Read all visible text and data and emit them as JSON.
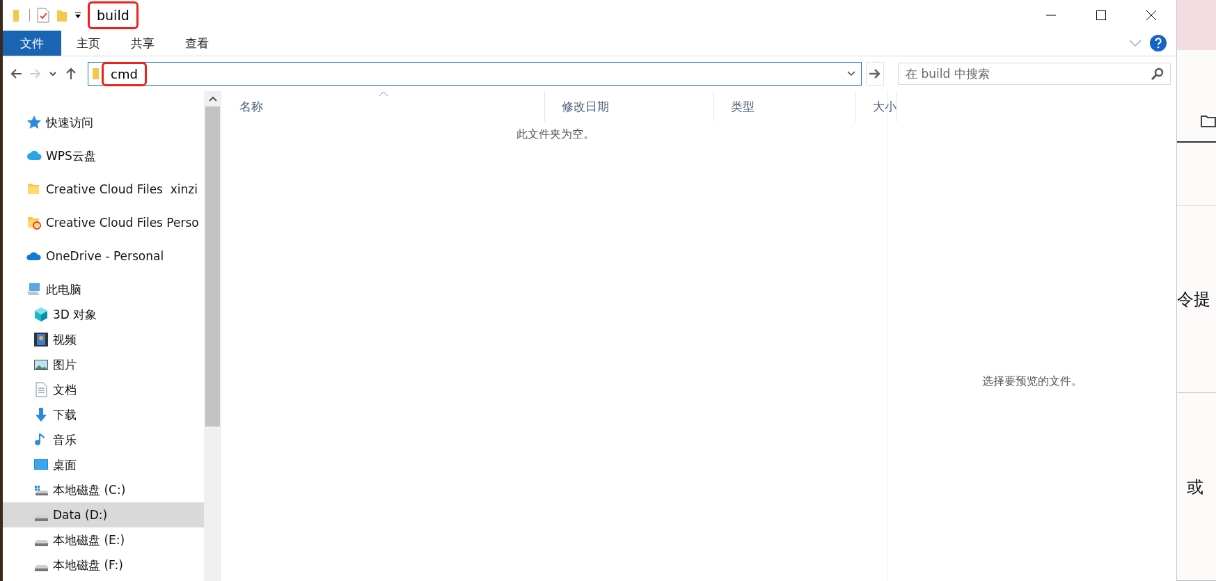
{
  "title_bar": {
    "title": "build",
    "title_highlighted": true
  },
  "ribbon": {
    "tabs": [
      {
        "label": "文件",
        "kind": "file-menu",
        "selected": false
      },
      {
        "label": "主页",
        "kind": "tab",
        "selected": false
      },
      {
        "label": "共享",
        "kind": "tab",
        "selected": false
      },
      {
        "label": "查看",
        "kind": "tab",
        "selected": false
      }
    ]
  },
  "address_bar": {
    "path": "cmd",
    "path_highlighted": true,
    "search_placeholder": "在 build 中搜索"
  },
  "navigation_pane": {
    "items": [
      {
        "label": "快速访问",
        "kind": "star",
        "selected": false
      },
      {
        "label": "WPS云盘",
        "kind": "cloud",
        "selected": false
      },
      {
        "label": "Creative Cloud Files  xinzi",
        "kind": "folder",
        "selected": false
      },
      {
        "label": "Creative Cloud Files Perso",
        "kind": "cc-folder",
        "selected": false
      },
      {
        "label": "OneDrive - Personal",
        "kind": "onedrive",
        "selected": false
      },
      {
        "label": "此电脑",
        "kind": "pc",
        "selected": false,
        "children": [
          {
            "label": "3D 对象",
            "kind": "cube",
            "selected": false
          },
          {
            "label": "视频",
            "kind": "video",
            "selected": false
          },
          {
            "label": "图片",
            "kind": "image",
            "selected": false
          },
          {
            "label": "文档",
            "kind": "document",
            "selected": false
          },
          {
            "label": "下载",
            "kind": "download",
            "selected": false
          },
          {
            "label": "音乐",
            "kind": "music",
            "selected": false
          },
          {
            "label": "桌面",
            "kind": "desktop",
            "selected": false
          },
          {
            "label": "本地磁盘 (C:)",
            "kind": "system-drive",
            "selected": false
          },
          {
            "label": "Data (D:)",
            "kind": "drive",
            "selected": true
          },
          {
            "label": "本地磁盘 (E:)",
            "kind": "drive",
            "selected": false
          },
          {
            "label": "本地磁盘 (F:)",
            "kind": "drive",
            "selected": false
          }
        ]
      }
    ]
  },
  "file_list": {
    "columns": [
      {
        "label": "名称",
        "sorted": true
      },
      {
        "label": "修改日期",
        "sorted": false
      },
      {
        "label": "类型",
        "sorted": false
      },
      {
        "label": "大小",
        "sorted": false
      }
    ],
    "empty_message": "此文件夹为空。"
  },
  "preview_pane": {
    "message": "选择要预览的文件。"
  },
  "background_window": {
    "texts": [
      "令提",
      "或"
    ]
  }
}
